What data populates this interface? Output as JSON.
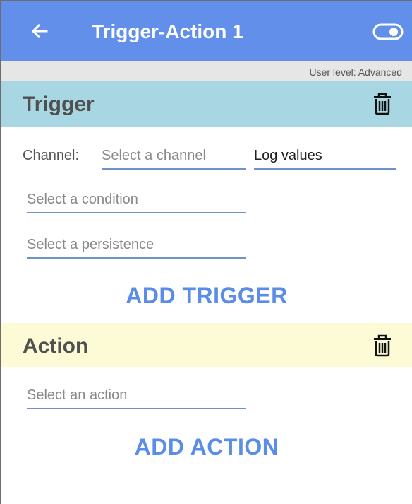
{
  "appbar": {
    "title": "Trigger-Action 1",
    "back_icon": "arrow-left-icon",
    "toggle_icon": "toggle-on-icon",
    "color": "#628fe9"
  },
  "user_level": "User level: Advanced",
  "trigger": {
    "title": "Trigger",
    "header_color": "#a9d6e3",
    "delete_icon": "trash-icon",
    "channel_label": "Channel:",
    "channel_placeholder": "Select a channel",
    "log_value": "Log values",
    "condition_placeholder": "Select a condition",
    "persistence_placeholder": "Select a persistence",
    "add_label": "ADD TRIGGER"
  },
  "action": {
    "title": "Action",
    "header_color": "#fdfbd6",
    "delete_icon": "trash-icon",
    "action_placeholder": "Select an action",
    "add_label": "ADD ACTION"
  }
}
